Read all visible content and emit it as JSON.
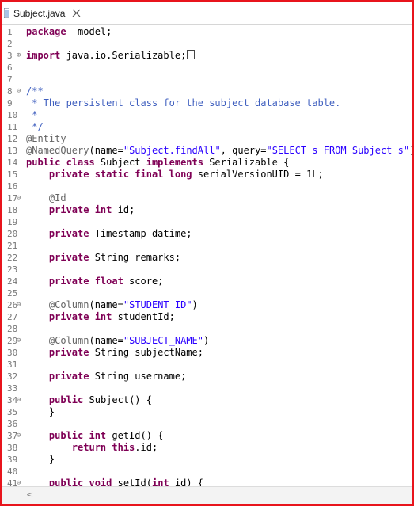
{
  "tab": {
    "label": "Subject.java"
  },
  "icons": {
    "file_icon": "java-file-icon",
    "close_icon": "close-icon",
    "scroll_left": "scroll-left-arrow"
  },
  "colors": {
    "keyword": "#7f0055",
    "string": "#2a00ff",
    "comment": "#3f5fbf",
    "annotation": "#646464",
    "frame": "#e8141c"
  },
  "scrollbar": {
    "left_arrow": "<"
  },
  "code_lines": [
    {
      "n": "1",
      "fold": "",
      "segs": [
        [
          "kw",
          "package"
        ],
        [
          "",
          "  model;"
        ]
      ]
    },
    {
      "n": "2",
      "fold": "",
      "segs": []
    },
    {
      "n": "3",
      "fold": "⊕",
      "segs": [
        [
          "kw",
          "import"
        ],
        [
          "",
          " java.io.Serializable;"
        ],
        [
          "box",
          ""
        ]
      ]
    },
    {
      "n": "6",
      "fold": "",
      "segs": []
    },
    {
      "n": "7",
      "fold": "",
      "segs": []
    },
    {
      "n": "8",
      "fold": "⊖",
      "segs": [
        [
          "cm",
          "/**"
        ]
      ]
    },
    {
      "n": "9",
      "fold": "",
      "segs": [
        [
          "cm",
          " * The persistent class for the subject database table."
        ]
      ]
    },
    {
      "n": "10",
      "fold": "",
      "segs": [
        [
          "cm",
          " *"
        ]
      ]
    },
    {
      "n": "11",
      "fold": "",
      "segs": [
        [
          "cm",
          " */"
        ]
      ]
    },
    {
      "n": "12",
      "fold": "",
      "segs": [
        [
          "ann",
          "@Entity"
        ]
      ]
    },
    {
      "n": "13",
      "fold": "",
      "segs": [
        [
          "ann",
          "@NamedQuery"
        ],
        [
          "",
          "(name="
        ],
        [
          "str",
          "\"Subject.findAll\""
        ],
        [
          "",
          ", query="
        ],
        [
          "str",
          "\"SELECT s FROM Subject s\""
        ],
        [
          "",
          ")"
        ]
      ]
    },
    {
      "n": "14",
      "fold": "",
      "segs": [
        [
          "kw",
          "public class"
        ],
        [
          "",
          " Subject "
        ],
        [
          "kw",
          "implements"
        ],
        [
          "",
          " Serializable {"
        ]
      ]
    },
    {
      "n": "15",
      "fold": "",
      "segs": [
        [
          "",
          "    "
        ],
        [
          "kw",
          "private static final long"
        ],
        [
          "",
          " serialVersionUID = 1L;"
        ]
      ]
    },
    {
      "n": "16",
      "fold": "",
      "segs": []
    },
    {
      "n": "17",
      "fold": "⊖",
      "segs": [
        [
          "",
          "    "
        ],
        [
          "ann",
          "@Id"
        ]
      ]
    },
    {
      "n": "18",
      "fold": "",
      "segs": [
        [
          "",
          "    "
        ],
        [
          "kw",
          "private int"
        ],
        [
          "",
          " id;"
        ]
      ]
    },
    {
      "n": "19",
      "fold": "",
      "segs": []
    },
    {
      "n": "20",
      "fold": "",
      "segs": [
        [
          "",
          "    "
        ],
        [
          "kw",
          "private"
        ],
        [
          "",
          " Timestamp datime;"
        ]
      ]
    },
    {
      "n": "21",
      "fold": "",
      "segs": []
    },
    {
      "n": "22",
      "fold": "",
      "segs": [
        [
          "",
          "    "
        ],
        [
          "kw",
          "private"
        ],
        [
          "",
          " String remarks;"
        ]
      ]
    },
    {
      "n": "23",
      "fold": "",
      "segs": []
    },
    {
      "n": "24",
      "fold": "",
      "segs": [
        [
          "",
          "    "
        ],
        [
          "kw",
          "private float"
        ],
        [
          "",
          " score;"
        ]
      ]
    },
    {
      "n": "25",
      "fold": "",
      "segs": []
    },
    {
      "n": "26",
      "fold": "⊖",
      "segs": [
        [
          "",
          "    "
        ],
        [
          "ann",
          "@Column"
        ],
        [
          "",
          "(name="
        ],
        [
          "str",
          "\"STUDENT_ID\""
        ],
        [
          "",
          ")"
        ]
      ]
    },
    {
      "n": "27",
      "fold": "",
      "segs": [
        [
          "",
          "    "
        ],
        [
          "kw",
          "private int"
        ],
        [
          "",
          " studentId;"
        ]
      ]
    },
    {
      "n": "28",
      "fold": "",
      "segs": []
    },
    {
      "n": "29",
      "fold": "⊖",
      "segs": [
        [
          "",
          "    "
        ],
        [
          "ann",
          "@Column"
        ],
        [
          "",
          "(name="
        ],
        [
          "str",
          "\"SUBJECT_NAME\""
        ],
        [
          "",
          ")"
        ]
      ]
    },
    {
      "n": "30",
      "fold": "",
      "segs": [
        [
          "",
          "    "
        ],
        [
          "kw",
          "private"
        ],
        [
          "",
          " String subjectName;"
        ]
      ]
    },
    {
      "n": "31",
      "fold": "",
      "segs": []
    },
    {
      "n": "32",
      "fold": "",
      "segs": [
        [
          "",
          "    "
        ],
        [
          "kw",
          "private"
        ],
        [
          "",
          " String username;"
        ]
      ]
    },
    {
      "n": "33",
      "fold": "",
      "segs": []
    },
    {
      "n": "34",
      "fold": "⊖",
      "segs": [
        [
          "",
          "    "
        ],
        [
          "kw",
          "public"
        ],
        [
          "",
          " Subject() {"
        ]
      ]
    },
    {
      "n": "35",
      "fold": "",
      "segs": [
        [
          "",
          "    }"
        ]
      ]
    },
    {
      "n": "36",
      "fold": "",
      "segs": []
    },
    {
      "n": "37",
      "fold": "⊖",
      "segs": [
        [
          "",
          "    "
        ],
        [
          "kw",
          "public int"
        ],
        [
          "",
          " getId() {"
        ]
      ]
    },
    {
      "n": "38",
      "fold": "",
      "segs": [
        [
          "",
          "        "
        ],
        [
          "kw",
          "return this"
        ],
        [
          "",
          ".id;"
        ]
      ]
    },
    {
      "n": "39",
      "fold": "",
      "segs": [
        [
          "",
          "    }"
        ]
      ]
    },
    {
      "n": "40",
      "fold": "",
      "segs": []
    },
    {
      "n": "41",
      "fold": "⊖",
      "segs": [
        [
          "",
          "    "
        ],
        [
          "kw",
          "public void"
        ],
        [
          "",
          " setId("
        ],
        [
          "kw",
          "int"
        ],
        [
          "",
          " id) {"
        ]
      ]
    }
  ]
}
